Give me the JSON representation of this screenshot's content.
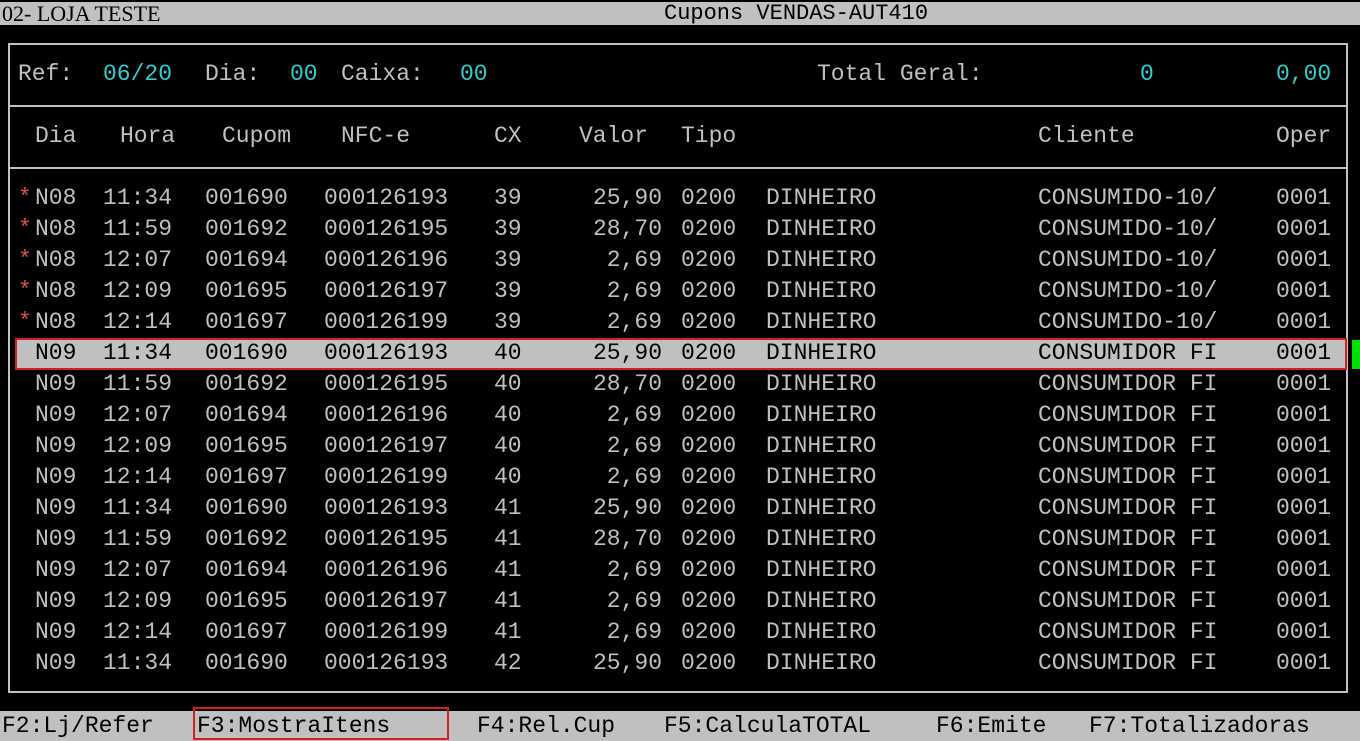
{
  "title_bar": {
    "store": "02- LOJA TESTE",
    "title": "Cupons VENDAS-AUT410"
  },
  "info": {
    "ref_label": "Ref:",
    "ref_value": "06/20",
    "dia_label": "Dia:",
    "dia_value": "00",
    "caixa_label": "Caixa:",
    "caixa_value": "00",
    "total_label": "Total Geral:",
    "total_count": "0",
    "total_value": "0,00"
  },
  "columns": {
    "dia": "Dia",
    "hora": "Hora",
    "cupom": "Cupom",
    "nfce": "NFC-e",
    "cx": "CX",
    "valor": "Valor",
    "tipo": "Tipo",
    "cliente": "Cliente",
    "oper": "Oper"
  },
  "rows": [
    {
      "mark": "*",
      "dia": "N08",
      "hora": "11:34",
      "cupom": "001690",
      "nfce": "000126193",
      "cx": "39",
      "valor": "25,90",
      "tipo": "0200",
      "pag": "DINHEIRO",
      "cliente": "CONSUMIDO-10/",
      "oper": "0001"
    },
    {
      "mark": "*",
      "dia": "N08",
      "hora": "11:59",
      "cupom": "001692",
      "nfce": "000126195",
      "cx": "39",
      "valor": "28,70",
      "tipo": "0200",
      "pag": "DINHEIRO",
      "cliente": "CONSUMIDO-10/",
      "oper": "0001"
    },
    {
      "mark": "*",
      "dia": "N08",
      "hora": "12:07",
      "cupom": "001694",
      "nfce": "000126196",
      "cx": "39",
      "valor": "2,69",
      "tipo": "0200",
      "pag": "DINHEIRO",
      "cliente": "CONSUMIDO-10/",
      "oper": "0001"
    },
    {
      "mark": "*",
      "dia": "N08",
      "hora": "12:09",
      "cupom": "001695",
      "nfce": "000126197",
      "cx": "39",
      "valor": "2,69",
      "tipo": "0200",
      "pag": "DINHEIRO",
      "cliente": "CONSUMIDO-10/",
      "oper": "0001"
    },
    {
      "mark": "*",
      "dia": "N08",
      "hora": "12:14",
      "cupom": "001697",
      "nfce": "000126199",
      "cx": "39",
      "valor": "2,69",
      "tipo": "0200",
      "pag": "DINHEIRO",
      "cliente": "CONSUMIDO-10/",
      "oper": "0001"
    },
    {
      "mark": "",
      "dia": "N09",
      "hora": "11:34",
      "cupom": "001690",
      "nfce": "000126193",
      "cx": "40",
      "valor": "25,90",
      "tipo": "0200",
      "pag": "DINHEIRO",
      "cliente": "CONSUMIDOR FI",
      "oper": "0001"
    },
    {
      "mark": "",
      "dia": "N09",
      "hora": "11:59",
      "cupom": "001692",
      "nfce": "000126195",
      "cx": "40",
      "valor": "28,70",
      "tipo": "0200",
      "pag": "DINHEIRO",
      "cliente": "CONSUMIDOR FI",
      "oper": "0001"
    },
    {
      "mark": "",
      "dia": "N09",
      "hora": "12:07",
      "cupom": "001694",
      "nfce": "000126196",
      "cx": "40",
      "valor": "2,69",
      "tipo": "0200",
      "pag": "DINHEIRO",
      "cliente": "CONSUMIDOR FI",
      "oper": "0001"
    },
    {
      "mark": "",
      "dia": "N09",
      "hora": "12:09",
      "cupom": "001695",
      "nfce": "000126197",
      "cx": "40",
      "valor": "2,69",
      "tipo": "0200",
      "pag": "DINHEIRO",
      "cliente": "CONSUMIDOR FI",
      "oper": "0001"
    },
    {
      "mark": "",
      "dia": "N09",
      "hora": "12:14",
      "cupom": "001697",
      "nfce": "000126199",
      "cx": "40",
      "valor": "2,69",
      "tipo": "0200",
      "pag": "DINHEIRO",
      "cliente": "CONSUMIDOR FI",
      "oper": "0001"
    },
    {
      "mark": "",
      "dia": "N09",
      "hora": "11:34",
      "cupom": "001690",
      "nfce": "000126193",
      "cx": "41",
      "valor": "25,90",
      "tipo": "0200",
      "pag": "DINHEIRO",
      "cliente": "CONSUMIDOR FI",
      "oper": "0001"
    },
    {
      "mark": "",
      "dia": "N09",
      "hora": "11:59",
      "cupom": "001692",
      "nfce": "000126195",
      "cx": "41",
      "valor": "28,70",
      "tipo": "0200",
      "pag": "DINHEIRO",
      "cliente": "CONSUMIDOR FI",
      "oper": "0001"
    },
    {
      "mark": "",
      "dia": "N09",
      "hora": "12:07",
      "cupom": "001694",
      "nfce": "000126196",
      "cx": "41",
      "valor": "2,69",
      "tipo": "0200",
      "pag": "DINHEIRO",
      "cliente": "CONSUMIDOR FI",
      "oper": "0001"
    },
    {
      "mark": "",
      "dia": "N09",
      "hora": "12:09",
      "cupom": "001695",
      "nfce": "000126197",
      "cx": "41",
      "valor": "2,69",
      "tipo": "0200",
      "pag": "DINHEIRO",
      "cliente": "CONSUMIDOR FI",
      "oper": "0001"
    },
    {
      "mark": "",
      "dia": "N09",
      "hora": "12:14",
      "cupom": "001697",
      "nfce": "000126199",
      "cx": "41",
      "valor": "2,69",
      "tipo": "0200",
      "pag": "DINHEIRO",
      "cliente": "CONSUMIDOR FI",
      "oper": "0001"
    },
    {
      "mark": "",
      "dia": "N09",
      "hora": "11:34",
      "cupom": "001690",
      "nfce": "000126193",
      "cx": "42",
      "valor": "25,90",
      "tipo": "0200",
      "pag": "DINHEIRO",
      "cliente": "CONSUMIDOR FI",
      "oper": "0001"
    }
  ],
  "selected_row": 5,
  "function_keys": [
    "F2:Lj/Refer",
    "F3:MostraItens",
    "F4:Rel.Cup",
    "F5:CalculaTOTAL",
    "F6:Emite",
    "F7:Totalizadoras"
  ],
  "colors": {
    "background": "#000000",
    "text": "#c0c0c0",
    "value": "#33cccc",
    "highlight_box": "#d02020",
    "marker": "#e05050",
    "scroll_marker": "#00e000"
  }
}
